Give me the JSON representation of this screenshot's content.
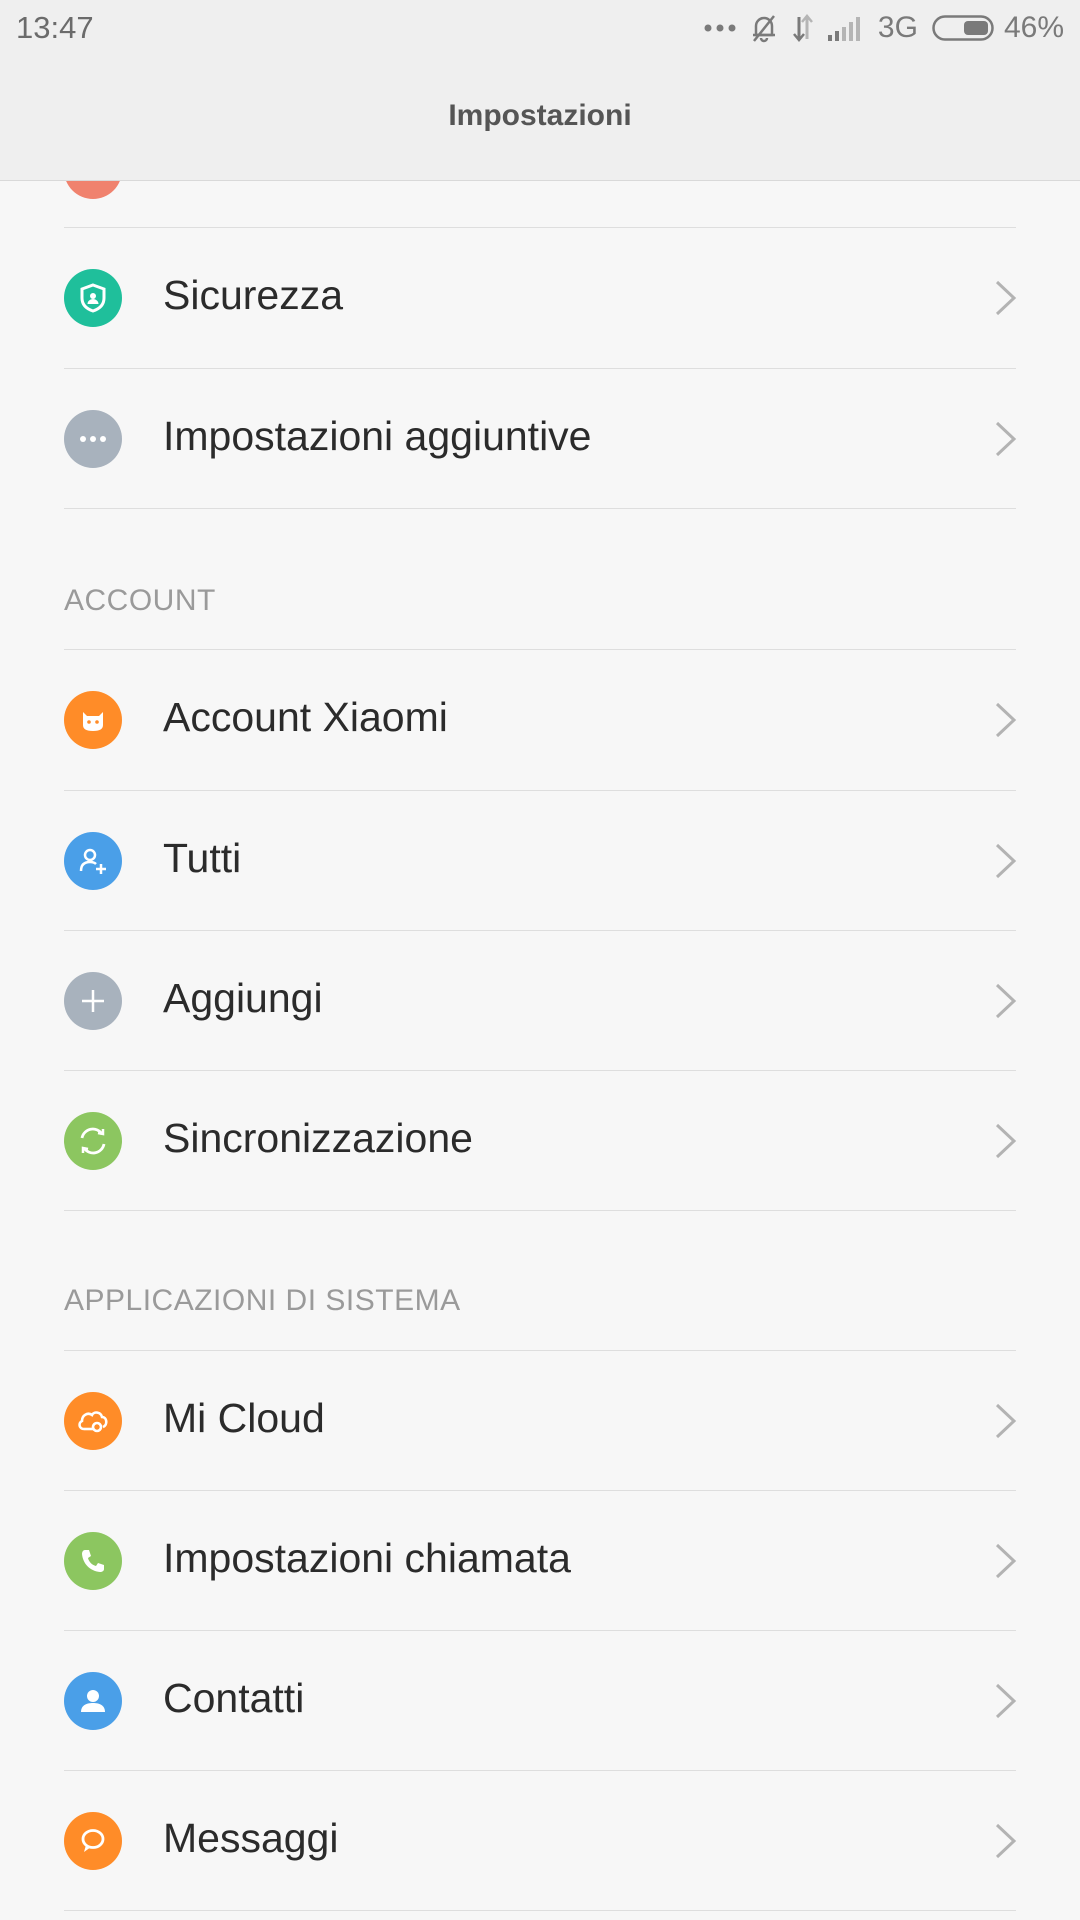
{
  "status_bar": {
    "time": "13:47",
    "network": "3G",
    "battery": "46%",
    "icons": [
      "more-dots-icon",
      "bell-muted-icon",
      "data-arrows-icon",
      "signal-icon",
      "battery-icon"
    ]
  },
  "header": {
    "title": "Impostazioni"
  },
  "colors": {
    "background": "#f7f7f7",
    "bar": "#efefef",
    "security": "#1fbf9b",
    "gray": "#a8b2bd",
    "orange": "#ff8c28",
    "blue": "#4a9fe8",
    "green": "#8cc660",
    "partial": "#f0826e"
  },
  "sections": [
    {
      "header": "",
      "items": [
        {
          "label": "Sicurezza",
          "icon": "shield-icon",
          "color": "#1fbf9b"
        },
        {
          "label": "Impostazioni aggiuntive",
          "icon": "more-dots-icon",
          "color": "#a8b2bd"
        }
      ]
    },
    {
      "header": "ACCOUNT",
      "items": [
        {
          "label": "Account Xiaomi",
          "icon": "mi-bunny-icon",
          "color": "#ff8c28"
        },
        {
          "label": "Tutti",
          "icon": "add-person-icon",
          "color": "#4a9fe8"
        },
        {
          "label": "Aggiungi",
          "icon": "plus-icon",
          "color": "#a8b2bd"
        },
        {
          "label": "Sincronizzazione",
          "icon": "sync-icon",
          "color": "#8cc660"
        }
      ]
    },
    {
      "header": "APPLICAZIONI DI SISTEMA",
      "items": [
        {
          "label": "Mi Cloud",
          "icon": "cloud-icon",
          "color": "#ff8c28"
        },
        {
          "label": "Impostazioni chiamata",
          "icon": "phone-icon",
          "color": "#8cc660"
        },
        {
          "label": "Contatti",
          "icon": "contact-icon",
          "color": "#4a9fe8"
        },
        {
          "label": "Messaggi",
          "icon": "message-icon",
          "color": "#ff8c28"
        }
      ]
    }
  ]
}
